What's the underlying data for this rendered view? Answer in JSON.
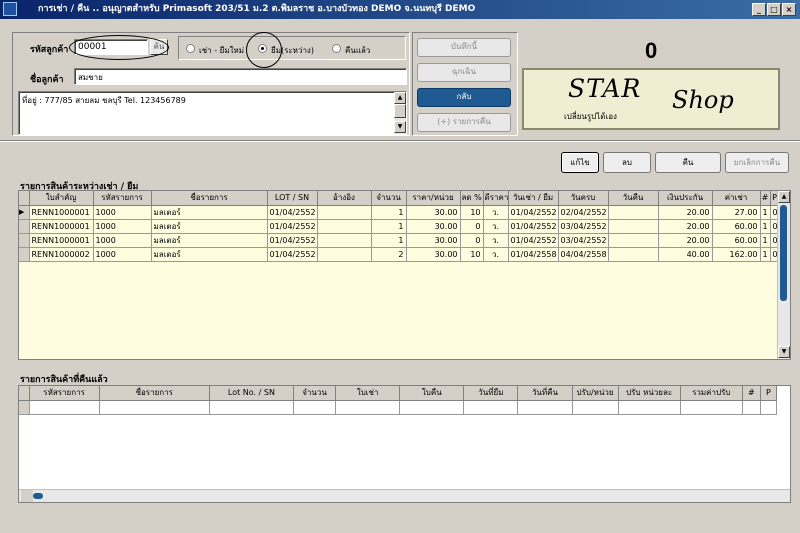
{
  "window": {
    "title": "การเช่า / คืน .. อนุญาตสำหรับ Primasoft 203/51 ม.2 ต.พิมลราช อ.บางบัวทอง DEMO จ.นนทบุรี DEMO",
    "min": "_",
    "max": "□",
    "close": "×"
  },
  "customer": {
    "code_label": "รหัสลูกค้า",
    "code_value": "00001",
    "search_btn": "ค้น",
    "name_label": "ชื่อลูกค้า",
    "name_value": "สมชาย",
    "address": "ที่อยู่ : 777/85 สายลม ชลบุรี  Tel. 123456789"
  },
  "mode": {
    "options": [
      "เช่า - ยืมใหม่",
      "ยืม(ระหว่าง)",
      "คืนแล้ว"
    ],
    "selected": 1
  },
  "actions": {
    "save_today": "บันทึกนี้",
    "emergency": "ฉุกเฉิน",
    "back": "กลับ",
    "add_item": "(+) รายการคืน"
  },
  "counter": {
    "value": "0"
  },
  "logo": {
    "star": "STAR",
    "shop": "Shop",
    "caption": "เปลี่ยนรูปได้เอง"
  },
  "toolbar": {
    "edit": "แก้ไข",
    "delete": "ลบ",
    "return": "คืน",
    "cancel_return": "ยกเลิกการคืน"
  },
  "borrowed": {
    "title": "รายการสินค้าระหว่างเช่า / ยืม",
    "columns": [
      "ใบสำคัญ",
      "รหัสรายการ",
      "ชื่อรายการ",
      "LOT / SN",
      "อ้างอิง",
      "จำนวน",
      "ราคา/หน่วย",
      "ลด %",
      "ดีราคา",
      "วันเช่า / ยืม",
      "วันครบ",
      "วันคืน",
      "เงินประกัน",
      "ค่าเช่า",
      "#",
      "P"
    ],
    "rows": [
      [
        "RENN1000001",
        "1000",
        "มลเตอร์",
        "01/04/2552",
        "",
        "1",
        "30.00",
        "10",
        "ว.",
        "01/04/2552",
        "02/04/2552",
        "",
        "20.00",
        "27.00",
        "1",
        "0"
      ],
      [
        "RENN1000001",
        "1000",
        "มลเตอร์",
        "01/04/2552",
        "",
        "1",
        "30.00",
        "0",
        "ว.",
        "01/04/2552",
        "03/04/2552",
        "",
        "20.00",
        "60.00",
        "1",
        "0"
      ],
      [
        "RENN1000001",
        "1000",
        "มลเตอร์",
        "01/04/2552",
        "",
        "1",
        "30.00",
        "0",
        "ว.",
        "01/04/2552",
        "03/04/2552",
        "",
        "20.00",
        "60.00",
        "1",
        "0"
      ],
      [
        "RENN1000002",
        "1000",
        "มลเตอร์",
        "01/04/2552",
        "",
        "2",
        "30.00",
        "10",
        "ว.",
        "01/04/2558",
        "04/04/2558",
        "",
        "40.00",
        "162.00",
        "1",
        "0"
      ]
    ]
  },
  "returned": {
    "title": "รายการสินค้าที่คืนแล้ว",
    "columns": [
      "รหัสรายการ",
      "ชื่อรายการ",
      "Lot No. / SN",
      "จำนวน",
      "ใบเช่า",
      "ใบคืน",
      "วันที่ยืม",
      "วันที่คืน",
      "ปรับ/หน่วย",
      "ปรับ หน่วยละ",
      "รวมค่าปรับ",
      "#",
      "P"
    ],
    "rows": []
  },
  "colors": {
    "title_bar": "#0a246a",
    "grid_bg": "#fffde0",
    "active_btn": "#1f5b92",
    "scroll_thumb": "#1f5b92"
  }
}
